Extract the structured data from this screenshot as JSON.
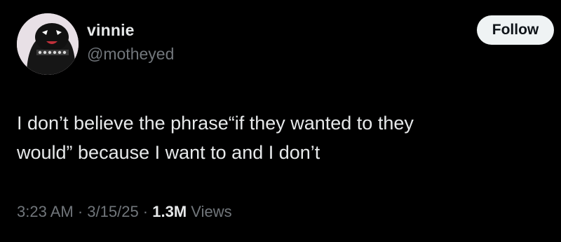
{
  "user": {
    "display_name": "vinnie",
    "handle": "@motheyed",
    "avatar": "profile-avatar"
  },
  "follow_button": {
    "label": "Follow"
  },
  "tweet": {
    "line1": "I don’t believe the phrase“if they wanted to they",
    "line2": "would” because I want to and I don’t"
  },
  "meta": {
    "time": "3:23 AM",
    "separator": " · ",
    "date": "3/15/25",
    "views_count": "1.3M",
    "views_label": "Views"
  },
  "colors": {
    "background": "#000000",
    "primary_text": "#e7e9ea",
    "secondary_text": "#71767b",
    "button_bg": "#eff3f4"
  }
}
